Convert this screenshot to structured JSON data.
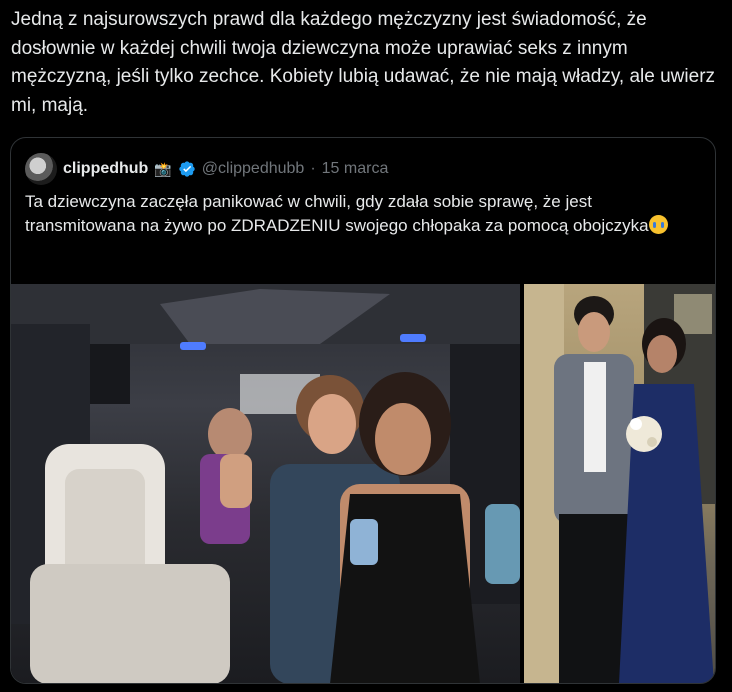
{
  "tweet": {
    "text": "Jedną z najsurowszych prawd dla każdego mężczyzny jest świadomość, że dosłownie w każdej chwili twoja dziewczyna może uprawiać seks z innym mężczyzną, jeśli tylko zechce. Kobiety lubią udawać, że nie mają władzy, ale uwierz mi, mają."
  },
  "quote": {
    "display_name": "clippedhub",
    "name_emoji": "📸",
    "handle": "@clippedhubb",
    "separator": "·",
    "date": "15 marca",
    "text": "Ta dziewczyna zaczęła panikować w chwili, gdy zdała sobie sprawę, że jest transmitowana na żywo po ZDRADZENIU swojego chłopaka za pomocą obojczyka",
    "text_emoji": "😭"
  },
  "colors": {
    "background": "#000000",
    "text": "#e7e9ea",
    "secondary": "#71767b",
    "border": "#2f3336",
    "verified": "#1d9bf0"
  }
}
